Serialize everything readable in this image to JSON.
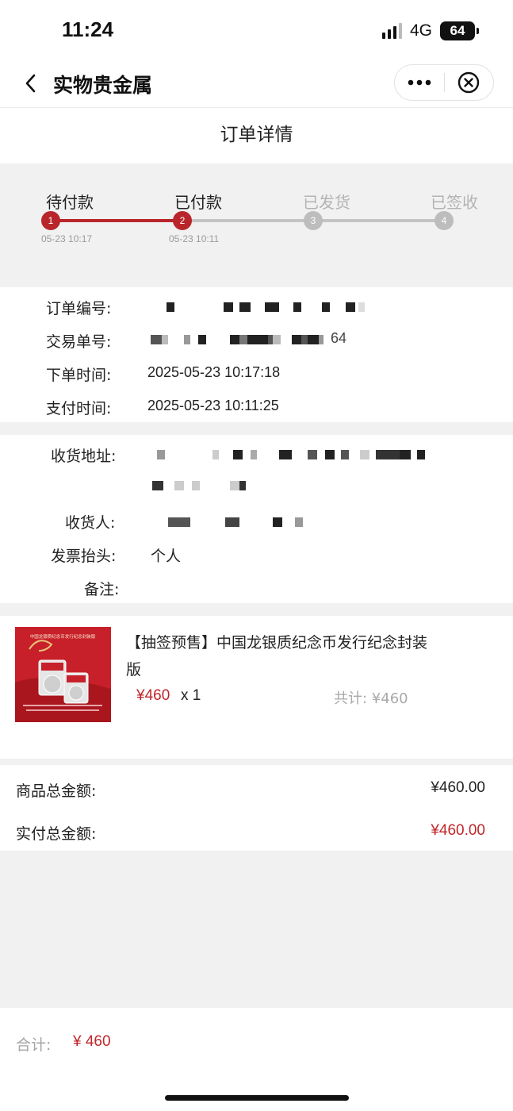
{
  "status_bar": {
    "time": "11:24",
    "network": "4G",
    "battery": "64"
  },
  "nav": {
    "title": "实物贵金属"
  },
  "page_title": "订单详情",
  "progress": {
    "steps": [
      {
        "label": "待付款",
        "number": "1",
        "time": "05-23 10:17",
        "done": true
      },
      {
        "label": "已付款",
        "number": "2",
        "time": "05-23 10:11",
        "done": true
      },
      {
        "label": "已发货",
        "number": "3",
        "time": "",
        "done": false
      },
      {
        "label": "已签收",
        "number": "4",
        "time": "",
        "done": false
      }
    ],
    "active_color": "#b8262b",
    "inactive_color": "#c4c4c4"
  },
  "order_info": {
    "order_no_label": "订单编号:",
    "trade_no_label": "交易单号:",
    "trade_no_tail": "64",
    "order_time_label": "下单时间:",
    "order_time": "2025-05-23 10:17:18",
    "pay_time_label": "支付时间:",
    "pay_time": "2025-05-23 10:11:25"
  },
  "shipping": {
    "address_label": "收货地址:",
    "receiver_label": "收货人:",
    "invoice_label": "发票抬头:",
    "invoice_value": "个人",
    "remark_label": "备注:"
  },
  "product": {
    "title": "【抽签预售】中国龙银质纪念币发行纪念封装版",
    "price": "¥460",
    "qty": "x 1",
    "total": "共计: ¥460",
    "image_caption": "中国龙银质纪念币发行纪念封装版"
  },
  "summary": {
    "goods_total_label": "商品总金额:",
    "goods_total": "¥460.00",
    "paid_total_label": "实付总金额:",
    "paid_total": "¥460.00"
  },
  "footer": {
    "label": "合计:",
    "value": "¥ 460"
  },
  "colors": {
    "accent_red": "#c0262b",
    "background_gray": "#f1f1f1"
  }
}
